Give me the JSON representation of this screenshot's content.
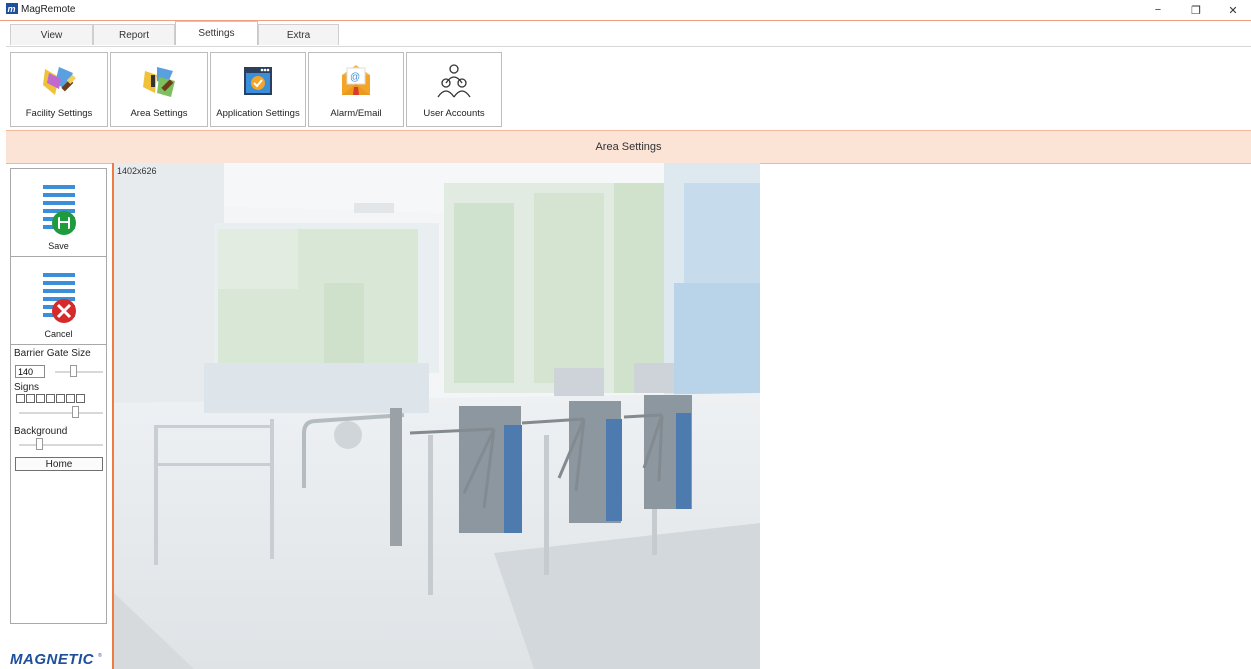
{
  "app": {
    "title": "MagRemote"
  },
  "window_controls": {
    "minimize": "−",
    "restore": "❐",
    "close": "✕"
  },
  "tabs": [
    {
      "label": "View"
    },
    {
      "label": "Report"
    },
    {
      "label": "Settings",
      "active": true
    },
    {
      "label": "Extra"
    }
  ],
  "ribbon": {
    "buttons": [
      {
        "label": "Facility Settings",
        "icon": "facility-settings-icon"
      },
      {
        "label": "Area Settings",
        "icon": "area-settings-icon"
      },
      {
        "label": "Application Settings",
        "icon": "application-settings-icon"
      },
      {
        "label": "Alarm/Email",
        "icon": "alarm-email-icon"
      },
      {
        "label": "User Accounts",
        "icon": "user-accounts-icon"
      }
    ]
  },
  "section": {
    "title": "Area Settings"
  },
  "sidebar": {
    "save_label": "Save",
    "cancel_label": "Cancel",
    "barrier_gate_size_label": "Barrier Gate Size",
    "barrier_gate_size_value": "140",
    "signs_label": "Signs",
    "background_label": "Background",
    "home_label": "Home"
  },
  "canvas": {
    "dimensions_label": "1402x626"
  },
  "brand": {
    "logo_text": "MAGNETIC"
  },
  "colors": {
    "accent": "#ef7a44",
    "section_bar": "#fbe3d6",
    "brand_blue": "#1d4f9a"
  }
}
